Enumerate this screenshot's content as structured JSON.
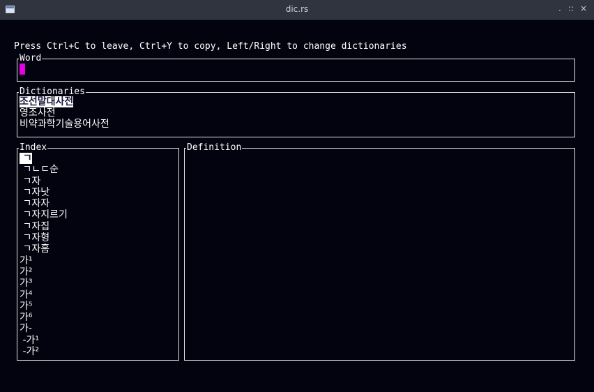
{
  "window": {
    "title": "dic.rs",
    "buttons": {
      "minimize": ".",
      "maximize": "::",
      "close": "×"
    }
  },
  "help_text": "Press Ctrl+C to leave, Ctrl+Y to copy, Left/Right to change dictionaries",
  "word": {
    "title": "Word",
    "value": ""
  },
  "dictionaries": {
    "title": "Dictionaries",
    "items": [
      {
        "label": "조선말대사전",
        "selected": true
      },
      {
        "label": "영조사전",
        "selected": false
      },
      {
        "label": "비약과학기술용어사전",
        "selected": false
      }
    ]
  },
  "index": {
    "title": "Index",
    "items": [
      {
        "label": " ㄱ",
        "selected": true
      },
      {
        "label": " ㄱㄴㄷ순"
      },
      {
        "label": " ㄱ자"
      },
      {
        "label": " ㄱ자낫"
      },
      {
        "label": " ㄱ자자"
      },
      {
        "label": " ㄱ자지르기"
      },
      {
        "label": " ㄱ자집"
      },
      {
        "label": " ㄱ자형"
      },
      {
        "label": " ㄱ자홈"
      },
      {
        "label": "가¹"
      },
      {
        "label": "가²"
      },
      {
        "label": "가³"
      },
      {
        "label": "가⁴"
      },
      {
        "label": "가⁵"
      },
      {
        "label": "가⁶"
      },
      {
        "label": "가-"
      },
      {
        "label": " -가¹"
      },
      {
        "label": " -가²"
      }
    ]
  },
  "definition": {
    "title": "Definition",
    "text": ""
  },
  "colors": {
    "background": "#03030f",
    "cursor": "#e600e6",
    "titlebar": "#2f343f"
  }
}
